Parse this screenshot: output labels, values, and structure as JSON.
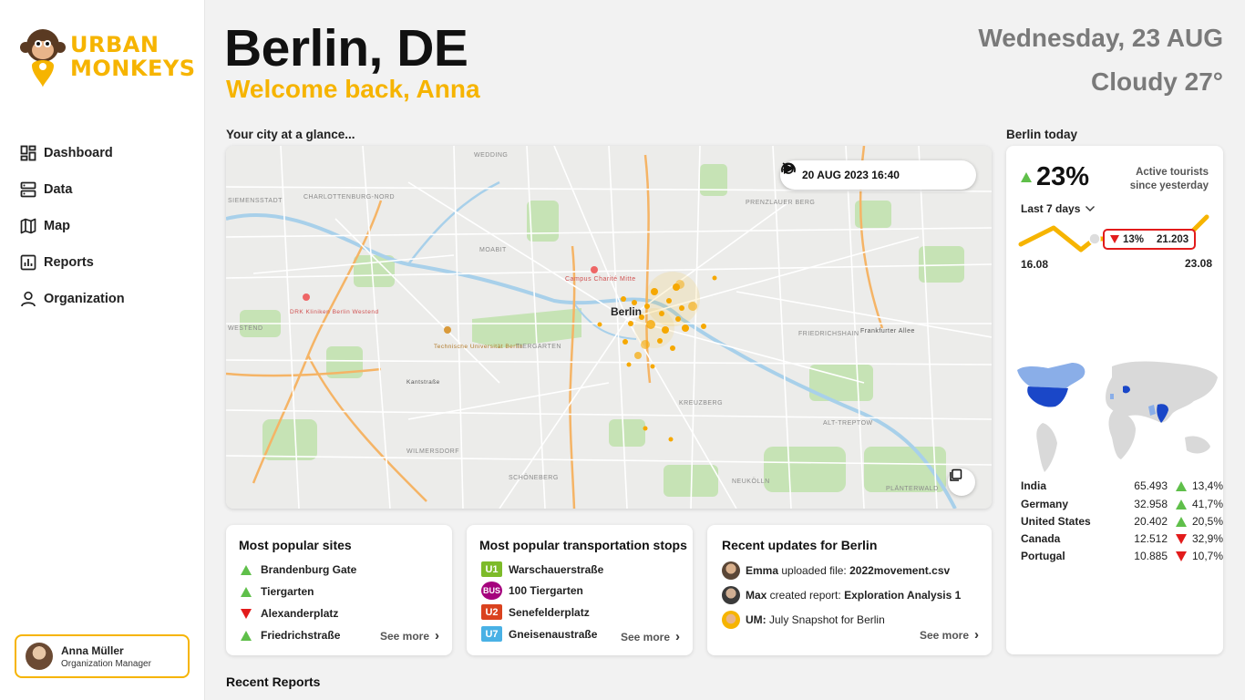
{
  "brand": {
    "line1": "URBAN",
    "line2": "MONKEYS"
  },
  "nav": [
    {
      "label": "Dashboard",
      "icon": "dashboard-icon"
    },
    {
      "label": "Data",
      "icon": "database-icon"
    },
    {
      "label": "Map",
      "icon": "map-icon"
    },
    {
      "label": "Reports",
      "icon": "reports-icon"
    },
    {
      "label": "Organization",
      "icon": "person-icon"
    }
  ],
  "user": {
    "name": "Anna Müller",
    "role": "Organization Manager"
  },
  "header": {
    "city": "Berlin, DE",
    "welcome": "Welcome back, Anna",
    "date": "Wednesday, 23 AUG",
    "weather": "Cloudy 27°"
  },
  "map": {
    "section_label": "Your city at a glance...",
    "timestamp": "20 AUG 2023 16:40",
    "labels": {
      "city": "Berlin",
      "wedding": "WEDDING",
      "charlottenburg": "CHARLOTTENBURG-NORD",
      "moabit": "MOABIT",
      "prenzlauer": "PRENZLAUER BERG",
      "westend": "WESTEND",
      "tiergarten": "TIERGARTEN",
      "friedrichshain": "FRIEDRICHSHAIN",
      "kreuzberg": "KREUZBERG",
      "wilmersdorf": "WILMERSDORF",
      "schoeneberg": "SCHÖNEBERG",
      "neukoelln": "NEUKÖLLN",
      "charite": "Campus Charité Mitte",
      "drk": "DRK Kliniken Berlin Westend",
      "tu": "Technische Universität Berlin",
      "frankfurter": "Frankfurter Allee",
      "kantstr": "Kantstraße",
      "alttreptow": "ALT-TREPTOW",
      "plaenterwald": "PLÄNTERWALD",
      "siemensstadt": "SIEMENSSTADT"
    }
  },
  "popular_sites": {
    "title": "Most popular sites",
    "items": [
      {
        "name": "Brandenburg Gate",
        "trend": "up"
      },
      {
        "name": "Tiergarten",
        "trend": "up"
      },
      {
        "name": "Alexanderplatz",
        "trend": "down"
      },
      {
        "name": "Friedrichstraße",
        "trend": "up"
      }
    ],
    "see_more": "See more"
  },
  "transport": {
    "title": "Most popular transportation stops",
    "items": [
      {
        "line": "U1",
        "name": "Warschauerstraße",
        "color": "#7dbb29"
      },
      {
        "line": "BUS",
        "name": "100 Tiergarten",
        "color": "#a5027d"
      },
      {
        "line": "U2",
        "name": "Senefelderplatz",
        "color": "#da421e"
      },
      {
        "line": "U7",
        "name": "Gneisenaustraße",
        "color": "#49b1e5"
      }
    ],
    "see_more": "See more"
  },
  "updates": {
    "title": "Recent updates for Berlin",
    "items": [
      {
        "who": "Emma",
        "action": " uploaded file: ",
        "object": "2022movement.csv"
      },
      {
        "who": "Max",
        "action": " created report: ",
        "object": "Exploration Analysis 1"
      },
      {
        "who": "UM:",
        "action": " July Snapshot for Berlin",
        "object": ""
      }
    ],
    "see_more": "See more"
  },
  "berlin_today": {
    "title": "Berlin today",
    "percent": "23%",
    "active_label_1": "Active tourists",
    "active_label_2": "since yesterday",
    "period": "Last 7 days",
    "tooltip_pct": "13%",
    "tooltip_value": "21.203",
    "axis_start": "16.08",
    "axis_end": "23.08",
    "countries": [
      {
        "name": "India",
        "value": "65.493",
        "change": "13,4%",
        "trend": "up"
      },
      {
        "name": "Germany",
        "value": "32.958",
        "change": "41,7%",
        "trend": "up"
      },
      {
        "name": "United States",
        "value": "20.402",
        "change": "20,5%",
        "trend": "up"
      },
      {
        "name": "Canada",
        "value": "12.512",
        "change": "32,9%",
        "trend": "down"
      },
      {
        "name": "Portugal",
        "value": "10.885",
        "change": "10,7%",
        "trend": "down"
      }
    ]
  },
  "colors": {
    "accent": "#f6b400",
    "up": "#5fbf4a",
    "down": "#e21b1b"
  },
  "recent_reports": "Recent Reports"
}
